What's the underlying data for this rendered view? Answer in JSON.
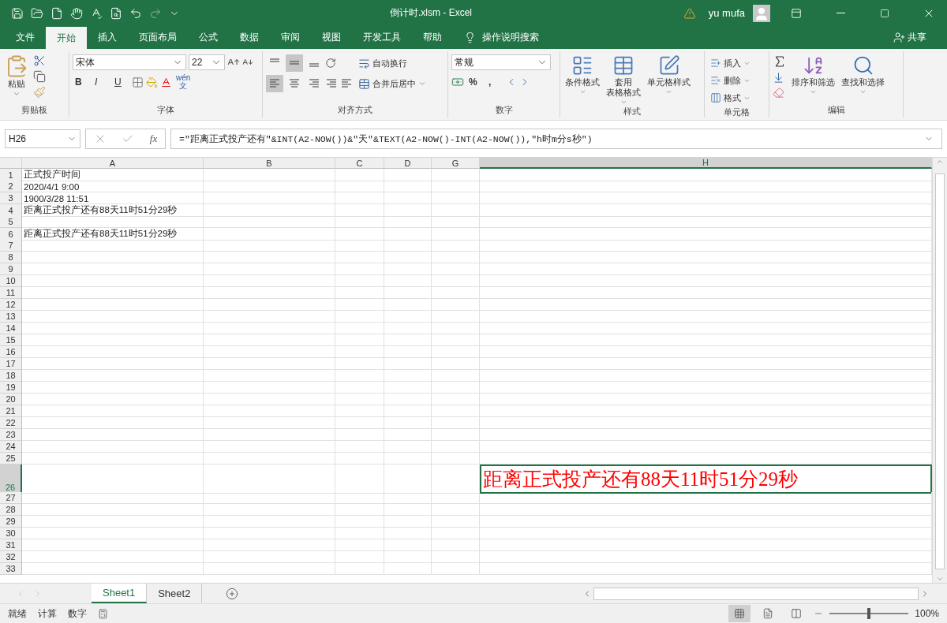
{
  "title_bar": {
    "file_title": "倒计时.xlsm  -  Excel",
    "user": "yu mufa"
  },
  "menu_tabs": [
    {
      "label": "文件",
      "selected": false
    },
    {
      "label": "开始",
      "selected": true
    },
    {
      "label": "插入",
      "selected": false
    },
    {
      "label": "页面布局",
      "selected": false
    },
    {
      "label": "公式",
      "selected": false
    },
    {
      "label": "数据",
      "selected": false
    },
    {
      "label": "审阅",
      "selected": false
    },
    {
      "label": "视图",
      "selected": false
    },
    {
      "label": "开发工具",
      "selected": false
    },
    {
      "label": "帮助",
      "selected": false
    }
  ],
  "tell_me": "操作说明搜索",
  "share": "共享",
  "ribbon": {
    "clipboard": {
      "paste": "粘贴",
      "label": "剪贴板"
    },
    "font": {
      "font_name": "宋体",
      "font_size": "22",
      "bold": "B",
      "italic": "I",
      "underline": "U",
      "phonetic_top": "wén",
      "phonetic_bottom": "文",
      "label": "字体"
    },
    "alignment": {
      "vertical": [
        {
          "selected": false
        },
        {
          "selected": true
        },
        {
          "selected": false
        }
      ],
      "horizontal": [
        {
          "selected": true
        },
        {
          "selected": false
        },
        {
          "selected": false
        }
      ],
      "wrap": "自动换行",
      "merge": "合并后居中",
      "label": "对齐方式"
    },
    "number": {
      "format": "常规",
      "percent": "%",
      "comma": ",",
      "label": "数字"
    },
    "styles": {
      "buttons": [
        {
          "lines": [
            "条件格式"
          ]
        },
        {
          "lines": [
            "套用",
            "表格格式"
          ]
        },
        {
          "lines": [
            "单元格样式"
          ]
        }
      ],
      "label": "样式"
    },
    "cells": {
      "buttons": [
        "插入",
        "删除",
        "格式"
      ],
      "label": "单元格"
    },
    "editing": {
      "buttons": [
        "排序和筛选",
        "查找和选择"
      ],
      "label": "编辑"
    }
  },
  "formula_bar": {
    "name_box": "H26",
    "function_label": "fx",
    "formula": "=\"距离正式投产还有\"&INT(A2-NOW())&\"天\"&TEXT(A2-NOW()-INT(A2-NOW()),\"h时m分s秒\")"
  },
  "columns": [
    {
      "label": "A",
      "selected": false
    },
    {
      "label": "B",
      "selected": false
    },
    {
      "label": "C",
      "selected": false
    },
    {
      "label": "D",
      "selected": false
    },
    {
      "label": "G",
      "selected": false
    },
    {
      "label": "H",
      "selected": true
    }
  ],
  "rows": [
    {
      "label": "1",
      "a": "正式投产时间",
      "selected": false
    },
    {
      "label": "2",
      "a": "2020/4/1 9:00",
      "selected": false
    },
    {
      "label": "3",
      "a": "1900/3/28 11:51",
      "selected": false
    },
    {
      "label": "4",
      "a": "距离正式投产还有88天11时51分29秒",
      "selected": false
    },
    {
      "label": "5",
      "selected": false
    },
    {
      "label": "6",
      "a": "距离正式投产还有88天11时51分29秒",
      "selected": false
    },
    {
      "label": "7",
      "selected": false
    },
    {
      "label": "8",
      "selected": false
    },
    {
      "label": "9",
      "selected": false
    },
    {
      "label": "10",
      "selected": false
    },
    {
      "label": "11",
      "selected": false
    },
    {
      "label": "12",
      "selected": false
    },
    {
      "label": "13",
      "selected": false
    },
    {
      "label": "14",
      "selected": false
    },
    {
      "label": "15",
      "selected": false
    },
    {
      "label": "16",
      "selected": false
    },
    {
      "label": "17",
      "selected": false
    },
    {
      "label": "18",
      "selected": false
    },
    {
      "label": "19",
      "selected": false
    },
    {
      "label": "20",
      "selected": false
    },
    {
      "label": "21",
      "selected": false
    },
    {
      "label": "22",
      "selected": false
    },
    {
      "label": "23",
      "selected": false
    },
    {
      "label": "24",
      "selected": false
    },
    {
      "label": "25",
      "selected": false
    },
    {
      "label": "26",
      "h": "距离正式投产还有88天11时51分29秒",
      "selected": true,
      "tall": true
    },
    {
      "label": "27",
      "selected": false
    },
    {
      "label": "28",
      "selected": false
    },
    {
      "label": "29",
      "selected": false
    },
    {
      "label": "30",
      "selected": false
    },
    {
      "label": "31",
      "selected": false
    },
    {
      "label": "32",
      "selected": false
    },
    {
      "label": "33",
      "selected": false
    }
  ],
  "sheet_tabs": [
    {
      "label": "Sheet1",
      "selected": true
    },
    {
      "label": "Sheet2",
      "selected": false
    }
  ],
  "status_bar": {
    "items": [
      "就绪",
      "计算",
      "数字"
    ],
    "views": [
      {
        "selected": true
      },
      {
        "selected": false
      },
      {
        "selected": false
      }
    ],
    "zoom": "100%",
    "zoom_slider": {
      "level": 0.5
    }
  }
}
